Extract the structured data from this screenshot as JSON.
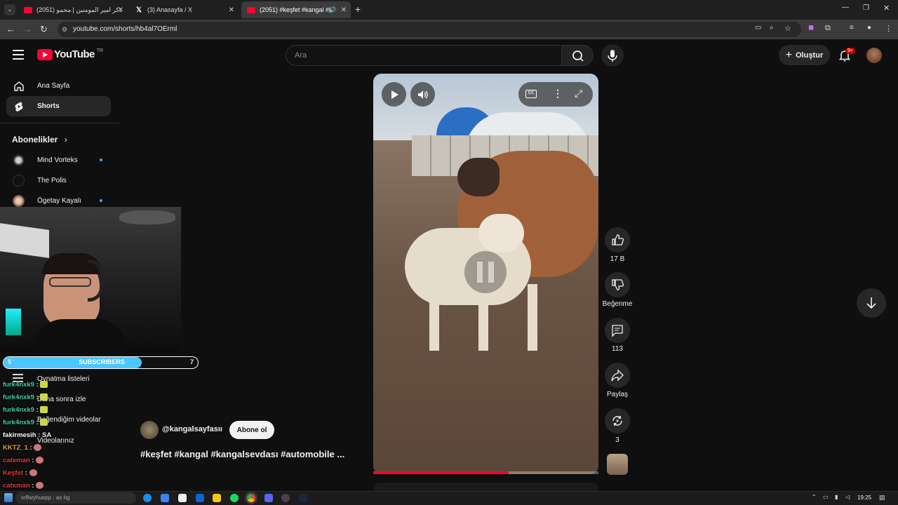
{
  "browser": {
    "tabs": [
      {
        "label": "(2051) ذكر امير المومنين | محمو",
        "icon": "youtube-icon"
      },
      {
        "label": "(3) Anasayfa / X",
        "icon": "x-icon"
      },
      {
        "label": "(2051) #keşfet #kangal #ka",
        "icon": "youtube-icon"
      }
    ],
    "url": "youtube.com/shorts/hb4al7OErml"
  },
  "header": {
    "logo_text": "YouTube",
    "country_code": "TR",
    "search_placeholder": "Ara",
    "create_label": "Oluştur",
    "notification_count": "9+"
  },
  "sidebar": {
    "items": [
      {
        "label": "Ana Sayfa",
        "icon": "home-icon"
      },
      {
        "label": "Shorts",
        "icon": "shorts-icon"
      }
    ],
    "subscriptions_title": "Abonelikler",
    "subscriptions": [
      {
        "name": "Mind Vorteks",
        "new": true
      },
      {
        "name": "The Polis",
        "new": false
      },
      {
        "name": "Ögetay Kayalı",
        "new": true
      }
    ],
    "library": [
      "Oynatma listeleri",
      "Daha sonra izle",
      "Beğendiğim videolar",
      "Videolarınız"
    ]
  },
  "overlay": {
    "subscriber_goal": {
      "current": "5",
      "label": "SUBSCRIBERS",
      "target": "7",
      "progress": 0.71
    },
    "chat": [
      {
        "user": "furk4nxk9",
        "msg": "",
        "color": "#3fd0a8",
        "emote": true
      },
      {
        "user": "furk4nxk9",
        "msg": "",
        "color": "#3fd0a8",
        "emote": true
      },
      {
        "user": "furk4nxk9",
        "msg": "",
        "color": "#3fd0a8",
        "emote": true
      },
      {
        "user": "furk4nxk9",
        "msg": "",
        "color": "#3fd0a8",
        "emote": true
      },
      {
        "user": "fakirmesih",
        "msg": "SA",
        "color": "#ffffff",
        "emote": false
      },
      {
        "user": "KKTZ_1",
        "msg": "",
        "color": "#e8a040",
        "emote": true
      },
      {
        "user": "catxman",
        "msg": "",
        "color": "#e03a3a",
        "emote": true
      },
      {
        "user": "Keşfet",
        "msg": "",
        "color": "#e03a3a",
        "emote": true
      },
      {
        "user": "catxman",
        "msg": "",
        "color": "#e03a3a",
        "emote": true
      }
    ]
  },
  "short": {
    "channel": "@kangalsayfasıı",
    "subscribe_label": "Abone ol",
    "title": "#keşfet #kangal #kangalsevdası #automobile ...",
    "progress": 0.6,
    "likes": "17 B",
    "dislike_label": "Beğenme",
    "comments": "113",
    "share_label": "Paylaş",
    "remix_count": "3"
  },
  "taskbar": {
    "search_text": "vr8wyhuepp : as hg",
    "time": "19:25"
  },
  "colors": {
    "accent": "#ff0033",
    "background": "#0f0f0f",
    "subscriber_bar": "#4cc6ff"
  }
}
